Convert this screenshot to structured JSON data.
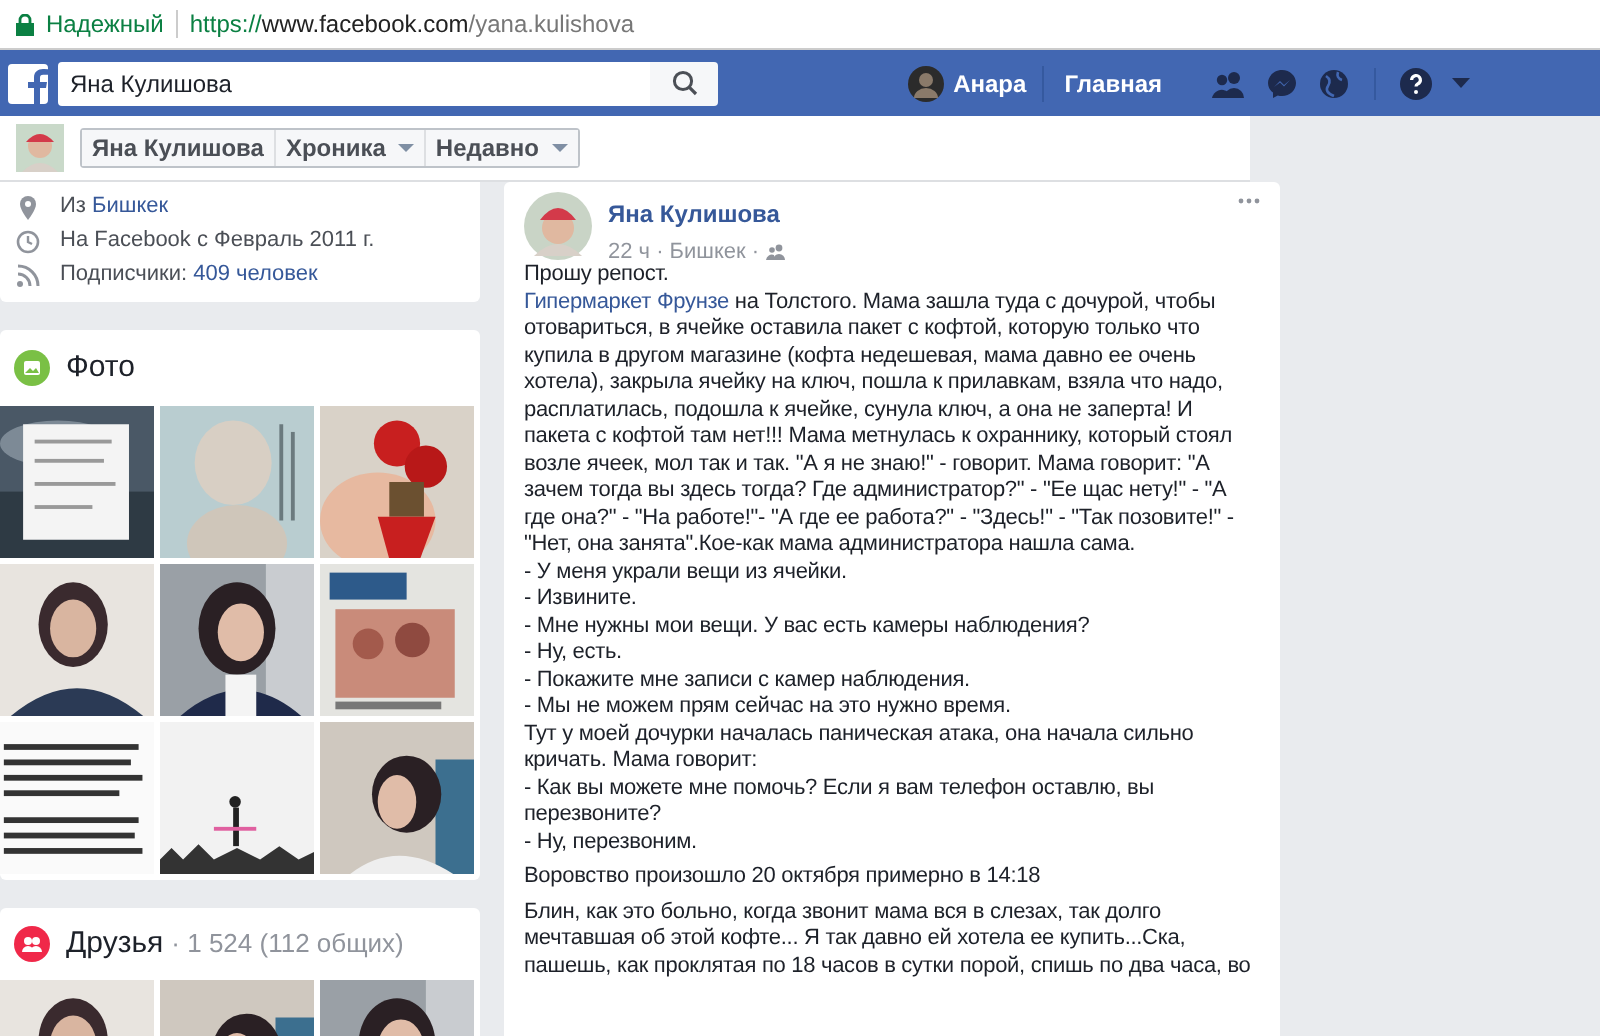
{
  "browser": {
    "security": "Надежный",
    "url": {
      "scheme": "https://",
      "host": "www.facebook.com",
      "path": "/yana.kulishova"
    }
  },
  "header": {
    "search": {
      "value": "Яна Кулишова"
    },
    "user": "Анара",
    "home": "Главная"
  },
  "subnav": {
    "items": [
      {
        "label": "Яна Кулишова",
        "dropdown": false
      },
      {
        "label": "Хроника",
        "dropdown": true
      },
      {
        "label": "Недавно",
        "dropdown": true
      }
    ]
  },
  "intro": {
    "items": [
      {
        "kind": "location",
        "text": "Из ",
        "link": "Бишкек"
      },
      {
        "kind": "clock",
        "text": "На Facebook с Февраль 2011 г."
      },
      {
        "kind": "followers",
        "text": "Подписчики: ",
        "link": "409 человек"
      }
    ]
  },
  "photos": {
    "title": "Фото"
  },
  "friends": {
    "title": "Друзья",
    "count": "· 1 524 (112 общих)"
  },
  "post": {
    "author": "Яна Кулишова",
    "meta": "22 ч · Бишкек ·",
    "paragraphs": [
      {
        "lines": [
          {
            "text": "Прошу репост."
          },
          {
            "link": "Гипермаркет Фрунзе",
            "text": " на Толстого. Мама зашла туда с дочурой, чтобы отовариться, в ячейке оставила пакет с кофтой, которую только что купила в другом магазине (кофта недешевая, мама давно ее очень хотела), закрыла ячейку на ключ, пошла к прилавкам, взяла что надо, расплатилась, подошла к ячейке, сунула ключ, а она не заперта! И пакета с кофтой там нет!!! Мама метнулась к охраннику, который стоял возле ячеек, мол так и так. \"А я не знаю!\" - говорит. Мама говорит: \"А зачем тогда вы здесь тогда? Где администратор?\" - \"Ее щас нету!\" - \"А где она?\" - \"На работе!\"- \"А где ее работа?\" - \"Здесь!\" - \"Так позовите!\" - \"Нет, она занята\".Кое-как мама администратора нашла сама."
          },
          {
            "text": "- У меня украли вещи из ячейки."
          },
          {
            "text": "- Извините."
          },
          {
            "text": "- Мне нужны мои вещи. У вас есть камеры наблюдения?"
          },
          {
            "text": "- Ну, есть."
          },
          {
            "text": "- Покажите мне записи с камер наблюдения."
          },
          {
            "text": "- Мы не можем прям сейчас на это нужно время."
          },
          {
            "text": "Тут у моей дочурки началась паническая атака, она начала сильно кричать. Мама говорит:"
          },
          {
            "text": "- Как вы можете мне помочь? Если я вам телефон оставлю, вы перезвоните?"
          },
          {
            "text": "- Ну, перезвоним."
          }
        ]
      },
      {
        "lines": [
          {
            "text": "Воровство произошло 20 октября примерно в 14:18"
          }
        ]
      },
      {
        "lines": [
          {
            "text": "Блин, как это больно, когда звонит мама вся в слезах, так долго мечтавшая об этой кофте... Я так давно ей хотела ее купить...Ска, пашешь, как проклятая по 18 часов в сутки порой, спишь по два часа, во"
          }
        ]
      }
    ]
  }
}
